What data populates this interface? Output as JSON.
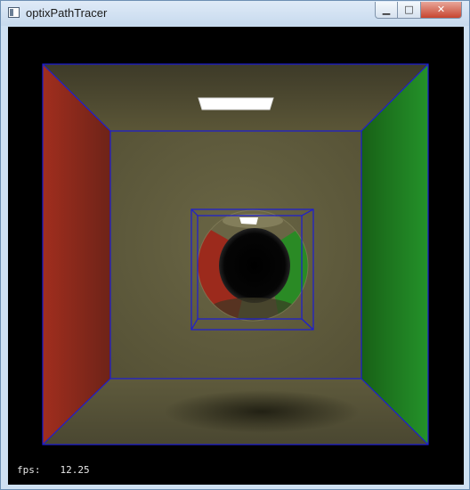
{
  "window": {
    "title": "optixPathTracer",
    "icon": "app-window-icon",
    "controls": {
      "minimize": "▁",
      "maximize": "□",
      "close": "✕"
    }
  },
  "scene": {
    "description_icons": [
      "cornell-box",
      "glass-sphere",
      "area-light"
    ],
    "colors": {
      "left_wall": "#8c2a1c",
      "right_wall": "#1f7a1c",
      "back_wall": "#5e5a38",
      "ceiling": "#4a4630",
      "floor": "#57543a",
      "bbox_lines": "#1a1ad0",
      "light": "#ffffff"
    }
  },
  "overlay": {
    "fps_label": "fps:",
    "fps_value": "12.25"
  }
}
